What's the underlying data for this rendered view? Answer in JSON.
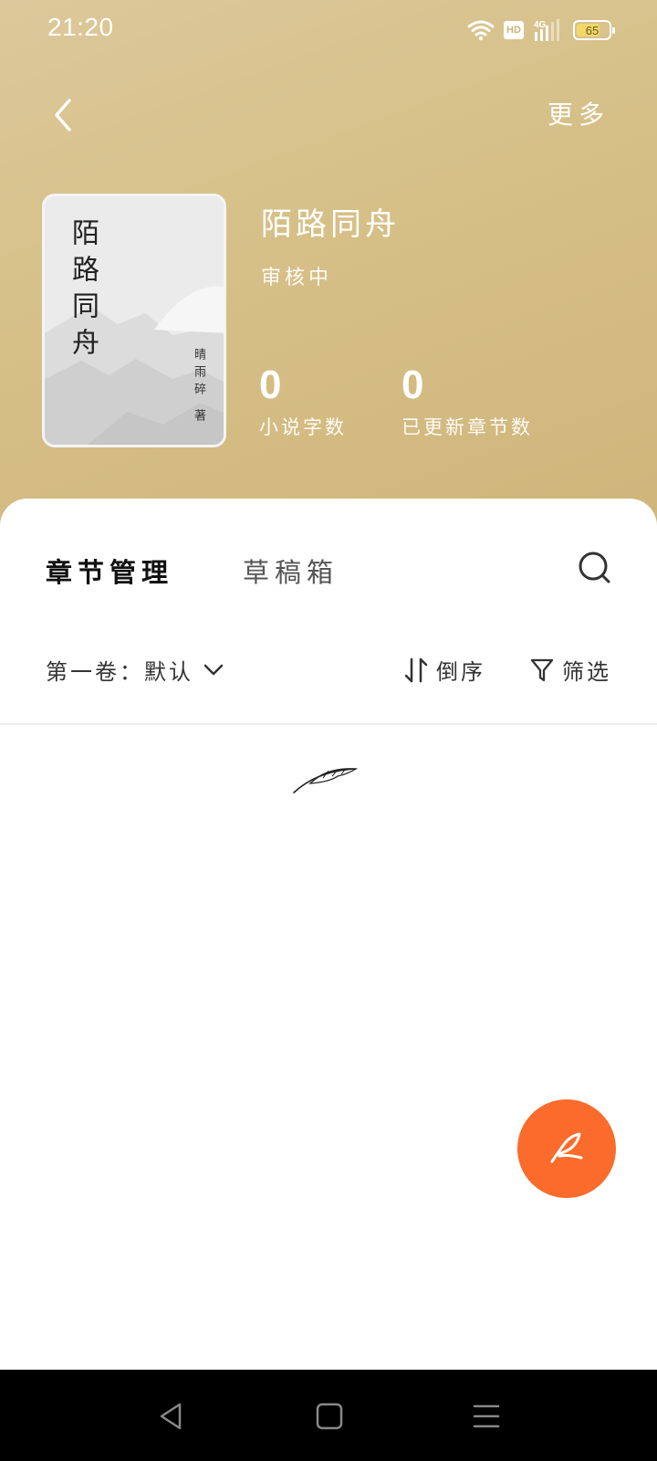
{
  "status_bar": {
    "time": "21:20",
    "hd_label": "HD",
    "network_label": "4G",
    "battery_level": "65",
    "battery_fraction": 0.65
  },
  "header": {
    "more_label": "更多"
  },
  "book": {
    "cover_title": "陌路同舟",
    "cover_author": "晴雨碎 著",
    "title": "陌路同舟",
    "status": "审核中",
    "stats": [
      {
        "value": "0",
        "label": "小说字数"
      },
      {
        "value": "0",
        "label": "已更新章节数"
      }
    ]
  },
  "tabs": [
    {
      "label": "章节管理",
      "active": true
    },
    {
      "label": "草稿箱",
      "active": false
    }
  ],
  "filters": {
    "volume": "第一卷：默认",
    "sort_label": "倒序",
    "filter_label": "筛选"
  },
  "colors": {
    "header_gold": "#d6c088",
    "fab_orange": "#fa6b2c",
    "nav_bar": "#000000"
  },
  "icons": {
    "back": "chevron-left-icon",
    "search": "search-icon",
    "volume_dropdown": "chevron-down-icon",
    "sort": "sort-icon",
    "filter": "funnel-icon",
    "empty": "feather-icon",
    "fab": "quill-pen-icon",
    "nav_back": "triangle-back-icon",
    "nav_home": "square-home-icon",
    "nav_menu": "menu-icon"
  }
}
